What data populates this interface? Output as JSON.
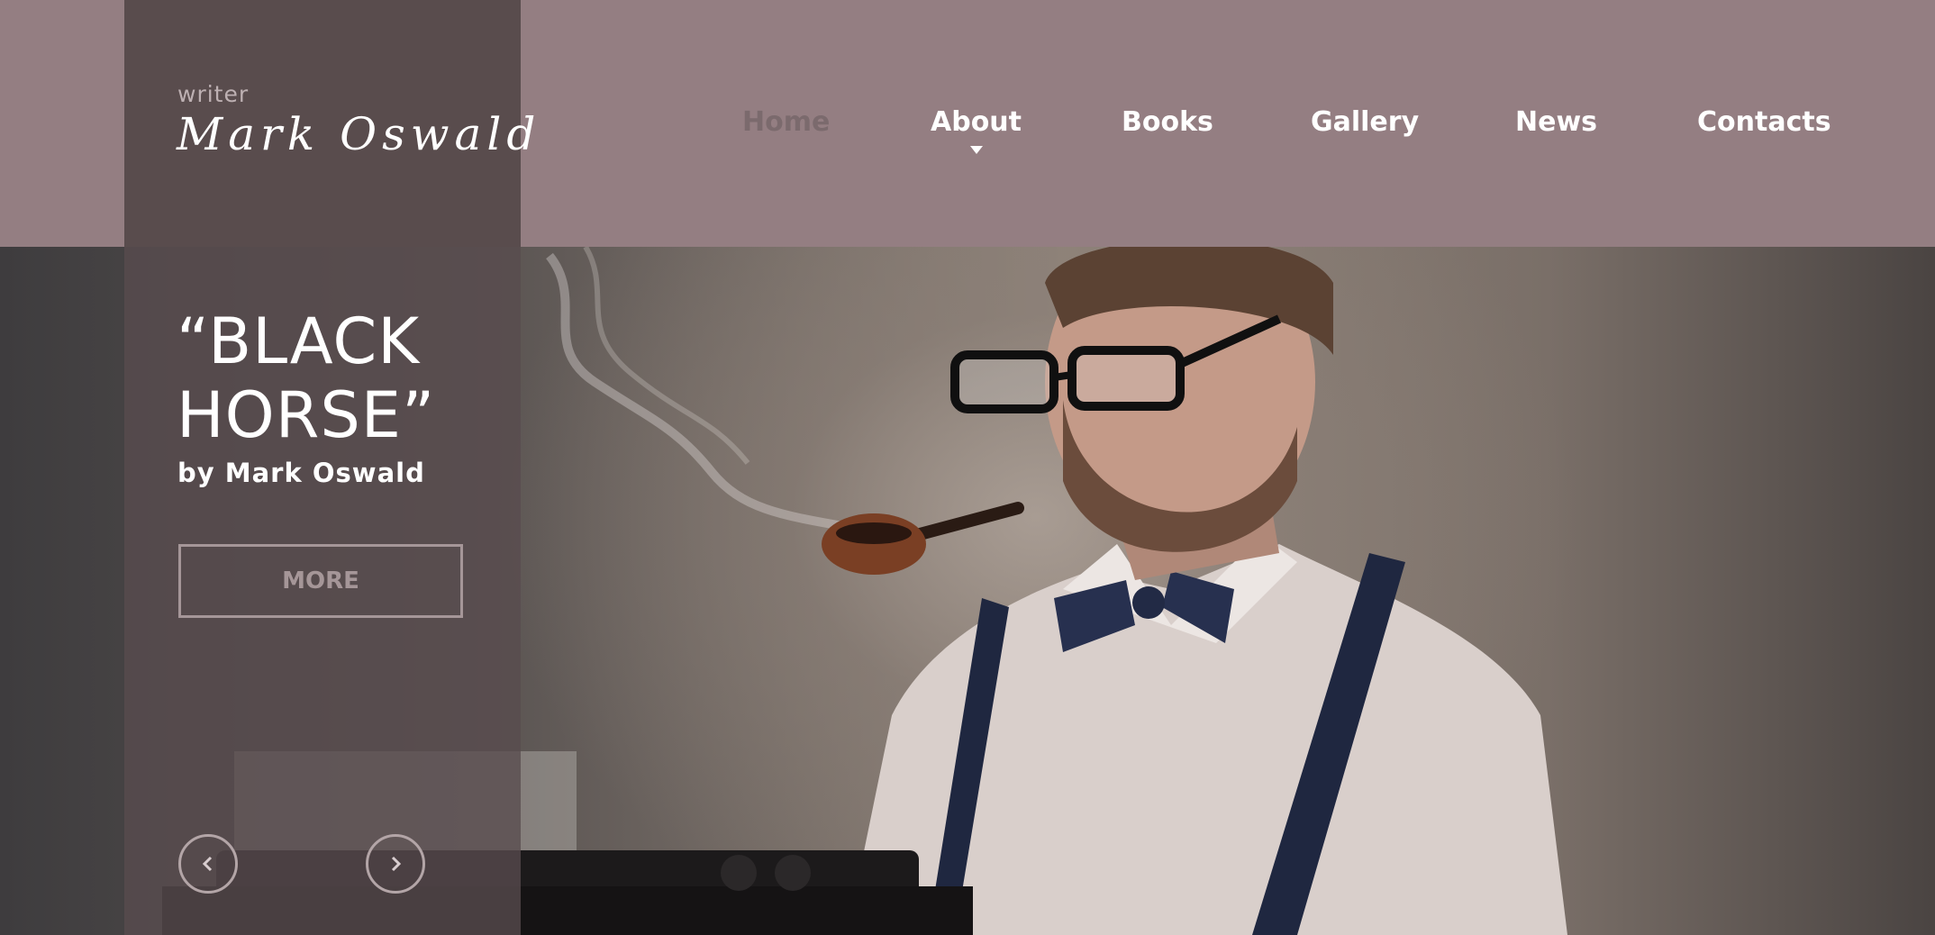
{
  "brand": {
    "subtitle": "writer",
    "name": "Mark Oswald"
  },
  "nav": {
    "items": [
      {
        "label": "Home",
        "active": true
      },
      {
        "label": "About",
        "has_dropdown": true
      },
      {
        "label": "Books"
      },
      {
        "label": "Gallery"
      },
      {
        "label": "News"
      },
      {
        "label": "Contacts"
      }
    ]
  },
  "hero": {
    "title": "“BLACK\nHORSE”",
    "byline": "by Mark Oswald",
    "more_label": "MORE",
    "prev_icon": "chevron-left-icon",
    "next_icon": "chevron-right-icon"
  },
  "colors": {
    "header_bg": "#947e82",
    "brand_bg": "#594c4d",
    "panel_bg": "#584c4e",
    "active_nav": "#7b6a6d",
    "text": "#ffffff"
  }
}
